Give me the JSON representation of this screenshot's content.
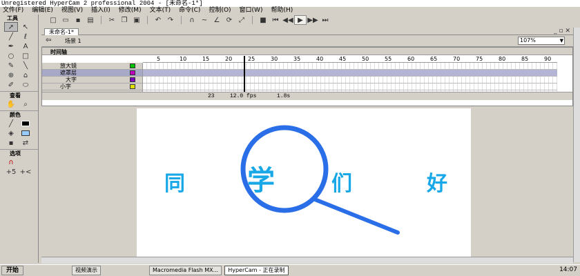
{
  "title": "Unregistered HyperCam 2 professional 2004 - [未命名-1*]",
  "menu": [
    "文件(F)",
    "编辑(E)",
    "视图(V)",
    "插入(I)",
    "修改(M)",
    "文本(T)",
    "命令(C)",
    "控制(O)",
    "窗口(W)",
    "帮助(H)"
  ],
  "tools_title": "工具",
  "section_view": "查看",
  "section_color": "颜色",
  "section_options": "选项",
  "doc_tab": "未命名-1*",
  "scene": "场景 1",
  "zoom": "107%",
  "timeline_title": "时间轴",
  "ruler_marks": [
    "5",
    "10",
    "15",
    "20",
    "25",
    "30",
    "35",
    "40",
    "45",
    "50",
    "55",
    "60",
    "65",
    "70",
    "75",
    "80",
    "85",
    "90"
  ],
  "layers": [
    {
      "name": "放大镜",
      "selected": false,
      "color": "#00c000"
    },
    {
      "name": "遮罩层",
      "selected": true,
      "color": "#c000c0"
    },
    {
      "name": "大字",
      "selected": false,
      "color": "#8000c0"
    },
    {
      "name": "小字",
      "selected": false,
      "color": "#e0e000"
    }
  ],
  "status": {
    "frame": "23",
    "fps": "12.0 fps",
    "time": "1.8s"
  },
  "stage_chars": [
    "同",
    "学",
    "们",
    "好"
  ],
  "taskbar": {
    "start": "开始",
    "tasks": [
      "视频演示",
      "Macromedia Flash MX...",
      "HyperCam - 正在录制"
    ],
    "clock": "14:07"
  }
}
